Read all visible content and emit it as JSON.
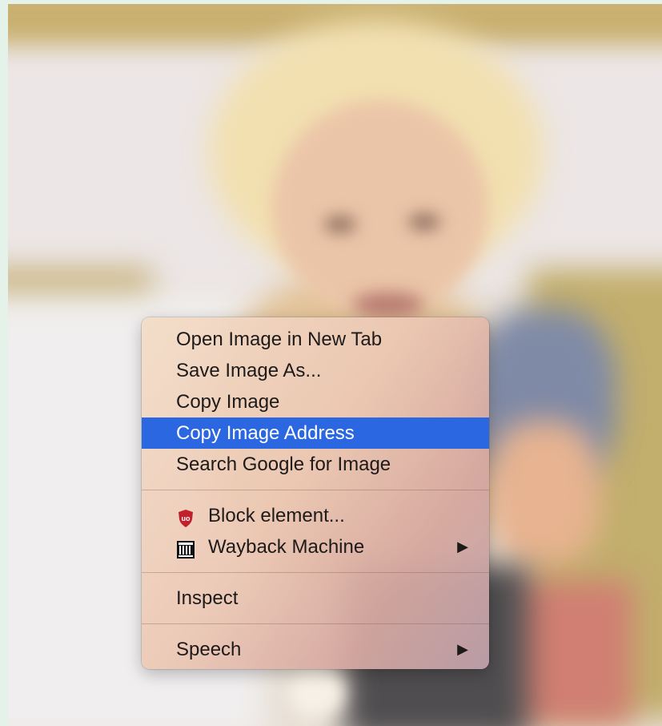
{
  "context_menu": {
    "items_group1": [
      {
        "label": "Open Image in New Tab"
      },
      {
        "label": "Save Image As..."
      },
      {
        "label": "Copy Image"
      },
      {
        "label": "Copy Image Address"
      },
      {
        "label": "Search Google for Image"
      }
    ],
    "items_group2": [
      {
        "label": "Block element...",
        "icon": "ublock-shield-icon"
      },
      {
        "label": "Wayback Machine",
        "icon": "wayback-machine-icon",
        "submenu": true
      }
    ],
    "items_group3": [
      {
        "label": "Inspect"
      }
    ],
    "items_group4": [
      {
        "label": "Speech",
        "submenu": true
      }
    ],
    "highlighted_item": "Copy Image Address",
    "submenu_arrow": "▶"
  },
  "colors": {
    "highlight": "#2b67e0",
    "ublock_red": "#c0212a",
    "background": "#e4f2ea"
  }
}
